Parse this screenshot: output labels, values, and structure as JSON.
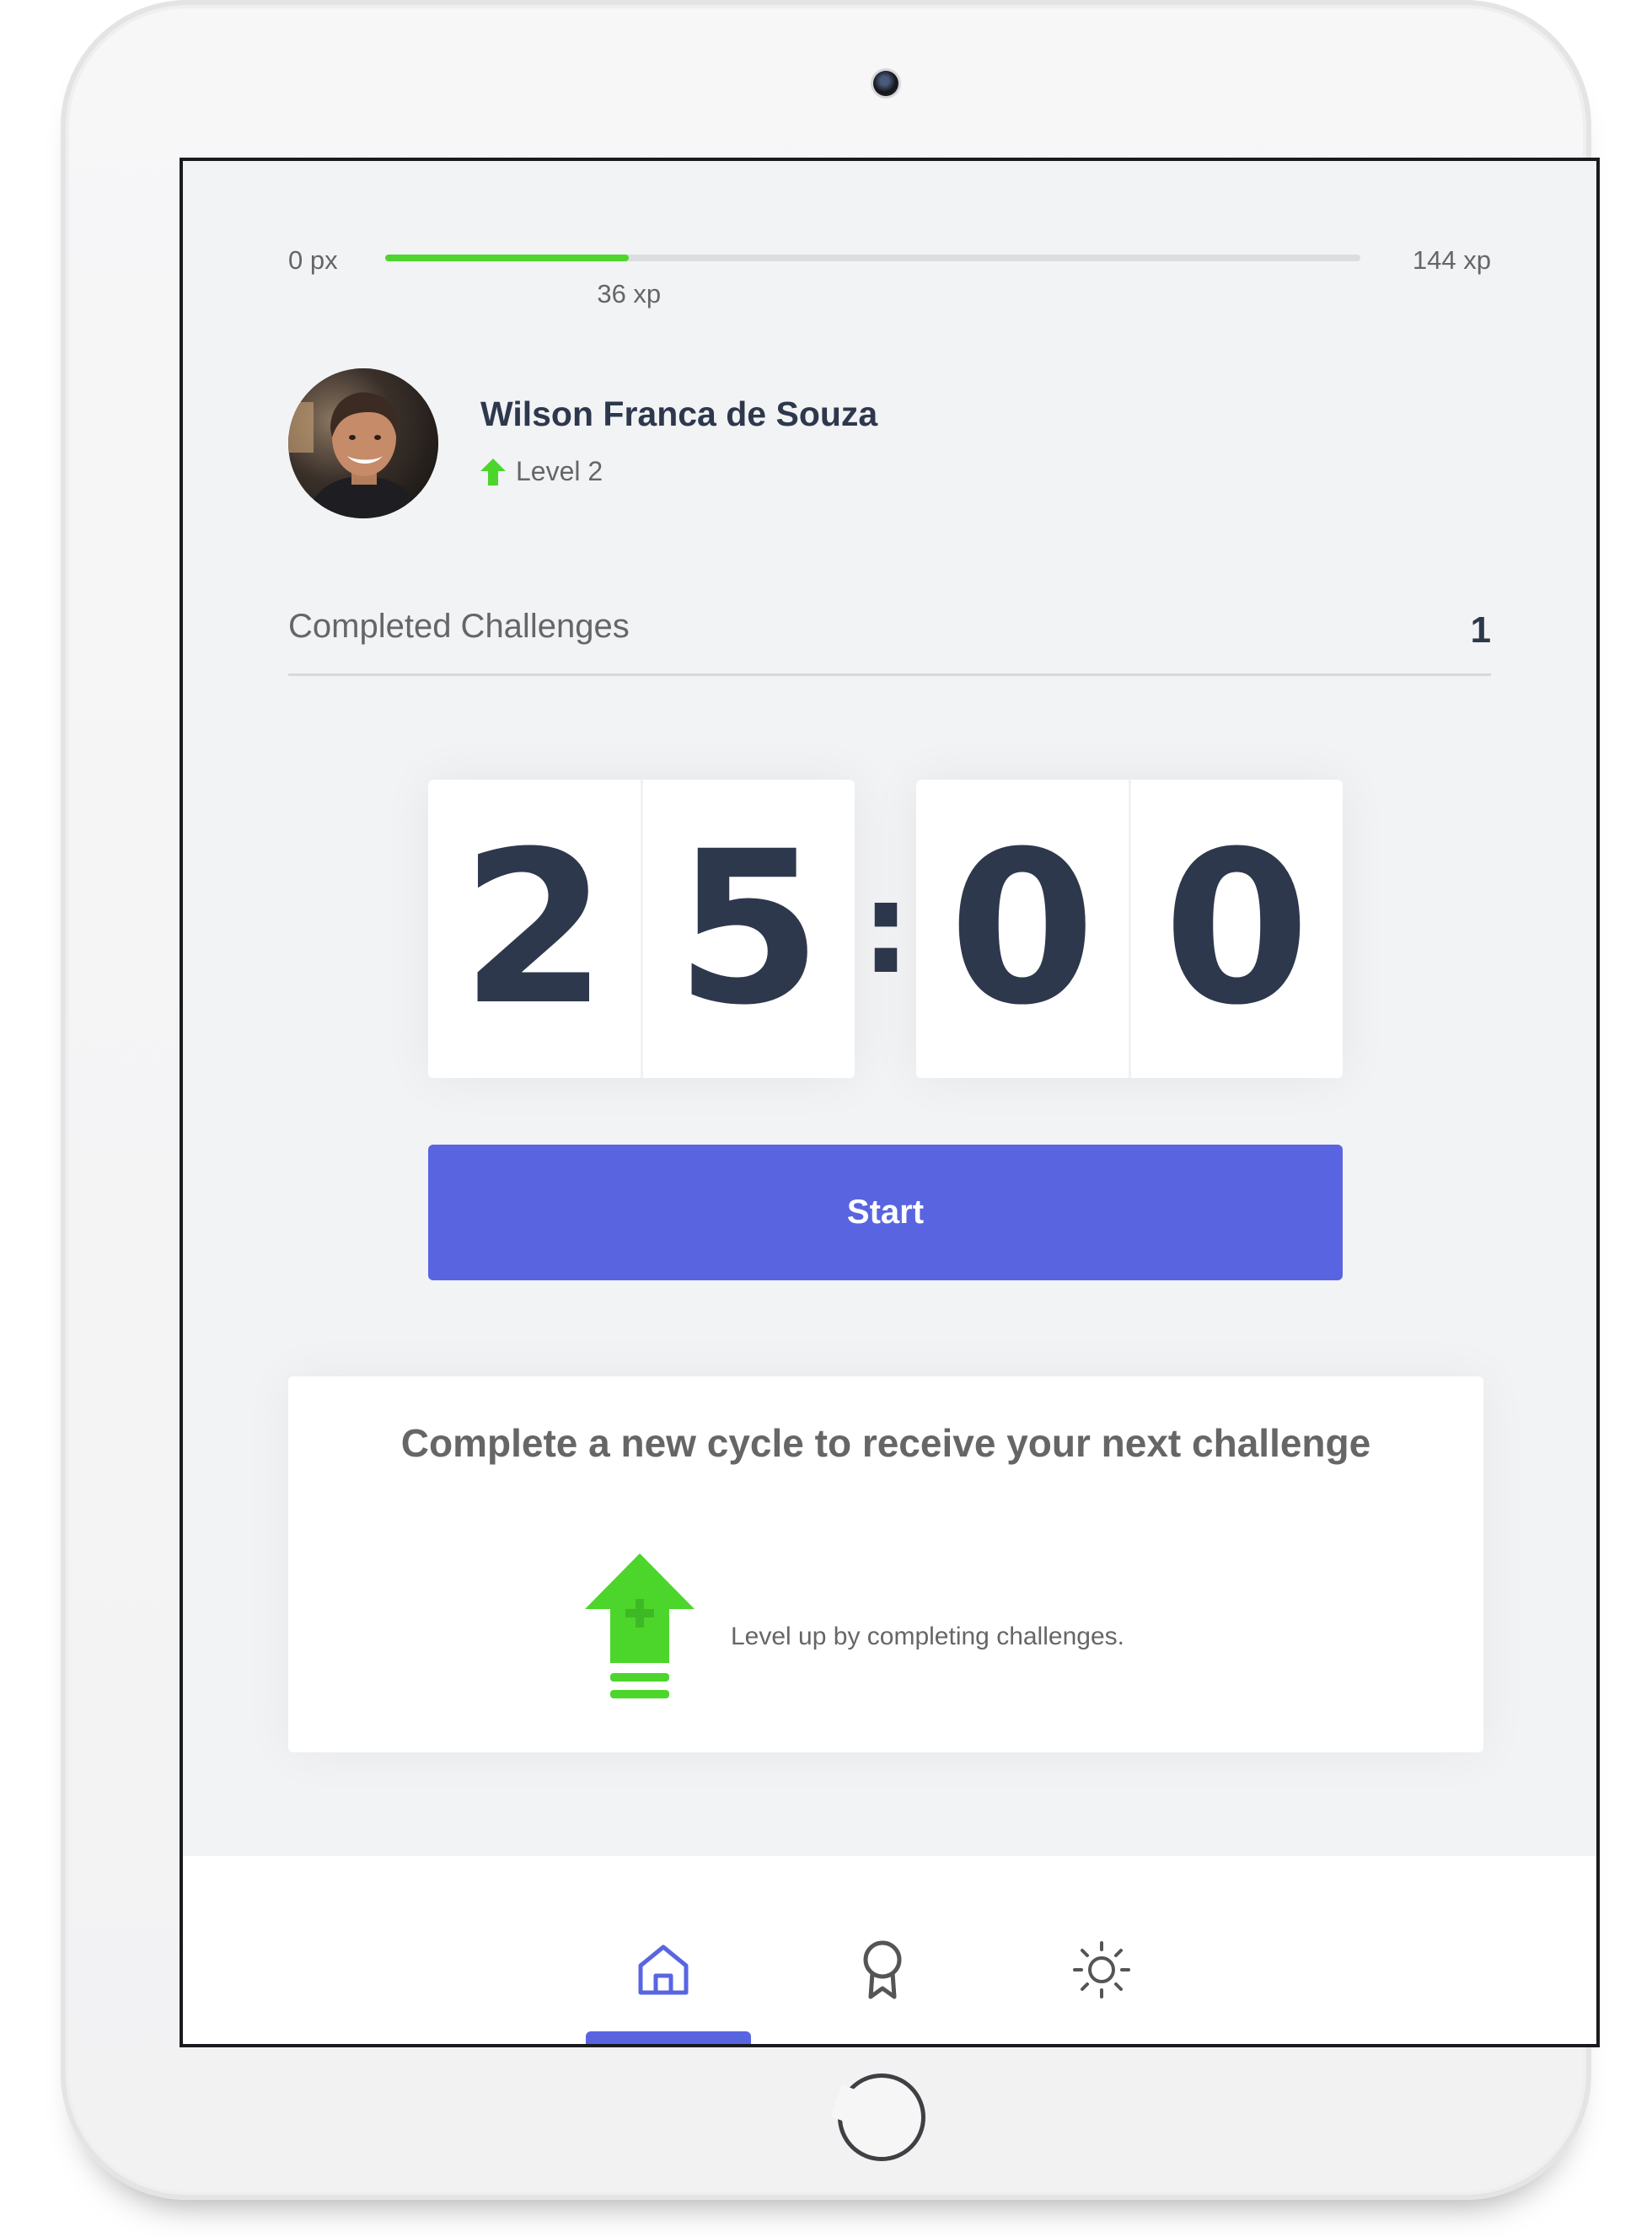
{
  "experience": {
    "min_label": "0 px",
    "max_label": "144 xp",
    "current_label": "36 xp",
    "progress_fraction": 0.25
  },
  "profile": {
    "name": "Wilson Franca de Souza",
    "level": "Level 2"
  },
  "completed": {
    "label": "Completed Challenges",
    "count": "1"
  },
  "countdown": {
    "minute_left": "2",
    "minute_right": "5",
    "separator": ":",
    "second_left": "0",
    "second_right": "0"
  },
  "start_button": {
    "label": "Start"
  },
  "challenge_box": {
    "title": "Complete a new cycle to receive your next challenge",
    "description": "Level up by completing challenges."
  },
  "nav": {
    "items": [
      {
        "icon": "home-icon",
        "active": true
      },
      {
        "icon": "award-icon",
        "active": false
      },
      {
        "icon": "sun-icon",
        "active": false
      }
    ]
  },
  "colors": {
    "accent": "#5965e0",
    "success": "#4cd62b",
    "text_title": "#2e384d",
    "text": "#666666",
    "background": "#f2f3f5"
  }
}
